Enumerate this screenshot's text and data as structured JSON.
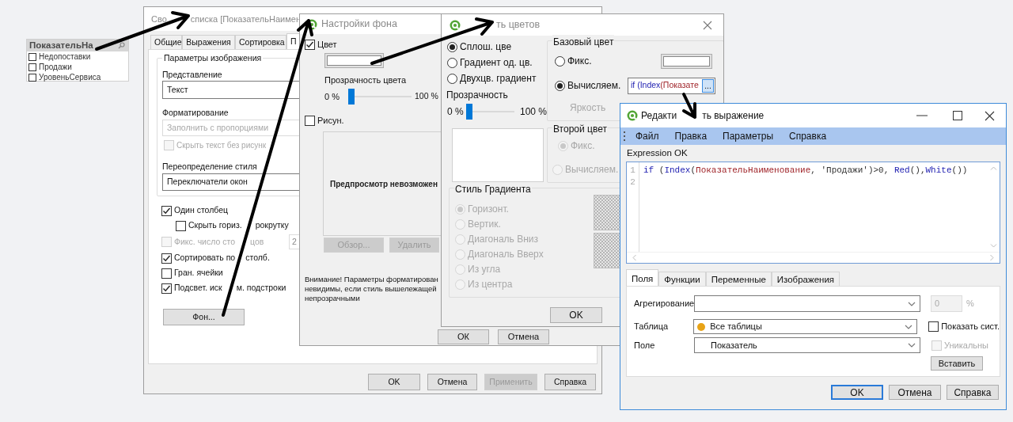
{
  "listbox": {
    "title": "ПоказательНа",
    "items": [
      {
        "label": "Недопоставки",
        "checked": false
      },
      {
        "label": "Продажи",
        "checked": false
      },
      {
        "label": "УровеньСервиса",
        "checked": false
      }
    ]
  },
  "properties_dialog": {
    "title_parts": [
      "Сво",
      "списка [ПоказательНаимен"
    ],
    "tabs": [
      {
        "label": "Общие",
        "selected": false
      },
      {
        "label": "Выражения",
        "selected": false
      },
      {
        "label": "Сортировка",
        "selected": false
      },
      {
        "label": "П",
        "selected": true
      }
    ],
    "group_title": "Параметры изображения",
    "representation": {
      "label": "Представление",
      "value": "Текст"
    },
    "formatting": {
      "label": "Форматирование",
      "value": "Заполнить с пропорциями",
      "disabled": true
    },
    "hide_text": {
      "label": "Скрыть текст без рисунк",
      "checked": false,
      "disabled": true
    },
    "style_override": {
      "label": "Переопределение стиля",
      "value": "Переключатели окон"
    },
    "options": [
      {
        "label": "Один столбец",
        "checked": true,
        "disabled": false,
        "children": [
          {
            "label_parts": [
              "Скрыть гориз.",
              "рокрутку"
            ],
            "checked": false,
            "disabled": false
          }
        ]
      },
      {
        "label_parts": [
          "Фикс. число сто",
          "цов"
        ],
        "checked": false,
        "disabled": true,
        "value": "2"
      },
      {
        "label_parts": [
          "Сортировать по",
          "столб."
        ],
        "checked": true,
        "disabled": false
      },
      {
        "label": "Гран. ячейки",
        "checked": false,
        "disabled": false
      },
      {
        "label_parts": [
          "Подсвет. иск",
          "м. подстроки"
        ],
        "checked": true,
        "disabled": false
      }
    ],
    "background_button": "Фон...",
    "buttons": [
      {
        "label": "OK",
        "disabled": false
      },
      {
        "label": "Отмена",
        "disabled": false
      },
      {
        "label": "Применить",
        "disabled": true
      },
      {
        "label": "Справка",
        "disabled": false
      }
    ]
  },
  "background_dialog": {
    "title": "Настройки фона",
    "color": {
      "label": "Цвет",
      "checked": true
    },
    "transparency": {
      "label": "Прозрачность цвета",
      "min": "0 %",
      "max": "100 %",
      "level": 0
    },
    "picture": {
      "label": "Рисун.",
      "checked": false
    },
    "preview_text": "Предпросмотр невозможен",
    "picture_buttons": [
      {
        "label": "Обзор...",
        "disabled": true
      },
      {
        "label": "Удалить",
        "disabled": true
      }
    ],
    "note_lines": [
      "Внимание! Параметры форматирован",
      "невидимы, если стиль вышележащей",
      "непрозрачными"
    ],
    "buttons": [
      {
        "label": "ОК"
      },
      {
        "label": "Отмена"
      }
    ]
  },
  "color_dialog": {
    "title": "ть цветов",
    "fill_modes": [
      {
        "label": "Сплош. цве",
        "selected": true
      },
      {
        "label": "Градиент од. цв.",
        "selected": false
      },
      {
        "label": "Двухцв. градиент",
        "selected": false
      }
    ],
    "transparency": {
      "label": "Прозрачность",
      "min": "0 %",
      "max": "100 %",
      "level": 0
    },
    "base_color": {
      "title": "Базовый цвет",
      "options": [
        {
          "label": "Фикс.",
          "selected": false
        },
        {
          "label": "Вычисляем.",
          "selected": true
        }
      ],
      "expression": [
        {
          "kind": "keyword",
          "text": "if (Index"
        },
        {
          "kind": "field",
          "text": "(Показате"
        }
      ],
      "browse_button": "...",
      "brightness": {
        "label": "Яркость",
        "disabled": true
      }
    },
    "second_color": {
      "title": "Второй цвет",
      "options": [
        {
          "label": "Фикс.",
          "selected": true,
          "disabled": true
        },
        {
          "label": "Вычисляем.",
          "selected": false,
          "disabled": true
        }
      ]
    },
    "gradient_style": {
      "title": "Стиль Градиента",
      "options": [
        {
          "label": "Горизонт.",
          "selected": true,
          "disabled": true
        },
        {
          "label": "Вертик.",
          "selected": false,
          "disabled": true
        },
        {
          "label": "Диагональ Вниз",
          "selected": false,
          "disabled": true
        },
        {
          "label": "Диагональ Вверх",
          "selected": false,
          "disabled": true
        },
        {
          "label": "Из угла",
          "selected": false,
          "disabled": true
        },
        {
          "label": "Из центра",
          "selected": false,
          "disabled": true
        }
      ]
    },
    "buttons": [
      {
        "label": "OK"
      }
    ]
  },
  "expression_editor": {
    "title_parts": [
      "Редакти",
      "ть выражение"
    ],
    "menu": [
      "Файл",
      "Правка",
      "Параметры",
      "Справка"
    ],
    "status": "Expression OK",
    "lines": [
      {
        "number": "1",
        "tokens": [
          {
            "kind": "keyword",
            "text": "if"
          },
          {
            "kind": "text",
            "text": " ("
          },
          {
            "kind": "keyword",
            "text": "Index"
          },
          {
            "kind": "text",
            "text": "("
          },
          {
            "kind": "field",
            "text": "ПоказательНаименование"
          },
          {
            "kind": "text",
            "text": ", 'Продажи')>0, "
          },
          {
            "kind": "keyword",
            "text": "Red"
          },
          {
            "kind": "text",
            "text": "(),"
          },
          {
            "kind": "keyword",
            "text": "White"
          },
          {
            "kind": "text",
            "text": "())"
          }
        ]
      },
      {
        "number": "2"
      }
    ],
    "tabs": [
      {
        "label": "Поля",
        "selected": true
      },
      {
        "label": "Функции",
        "selected": false
      },
      {
        "label": "Переменные",
        "selected": false
      },
      {
        "label": "Изображения",
        "selected": false
      }
    ],
    "aggregation": {
      "label": "Агрегирование"
    },
    "percent": {
      "value": "0",
      "unit": "%",
      "disabled": true
    },
    "table": {
      "label": "Таблица",
      "value": "Все таблицы",
      "color": "#e8a317"
    },
    "show_system": {
      "label": "Показать сист.",
      "checked": false,
      "disabled": false
    },
    "field": {
      "label": "Поле",
      "value": "Показатель"
    },
    "unique": {
      "label": "Уникальны",
      "checked": false,
      "disabled": true
    },
    "insert_button": "Вставить",
    "buttons": [
      {
        "label": "OK",
        "default": true
      },
      {
        "label": "Отмена",
        "default": false
      },
      {
        "label": "Справка",
        "default": false
      }
    ]
  }
}
